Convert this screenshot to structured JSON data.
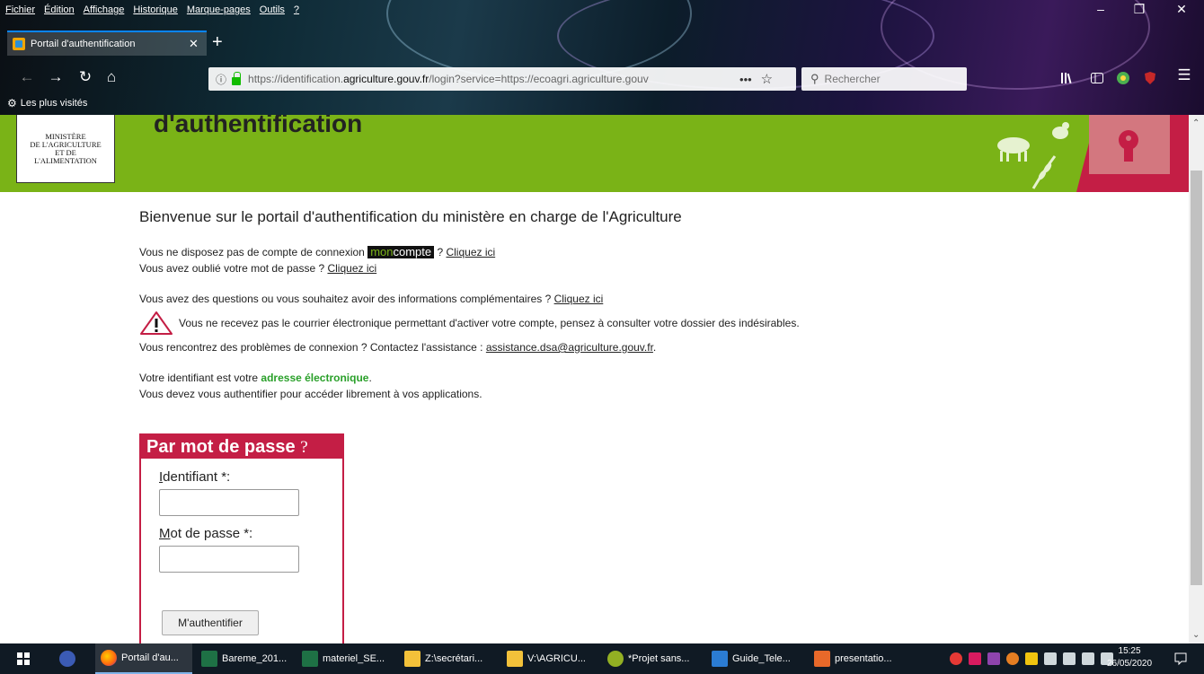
{
  "browser": {
    "menu": [
      "Fichier",
      "Édition",
      "Affichage",
      "Historique",
      "Marque-pages",
      "Outils",
      "?"
    ],
    "tab_title": "Portail d'authentification",
    "new_tab": "+",
    "url_host_prefix": "https://identification.",
    "url_domain": "agriculture.gouv.fr",
    "url_rest": "/login?service=https://ecoagri.agriculture.gouv",
    "search_placeholder": "Rechercher",
    "bookmark": "Les plus visités"
  },
  "banner": {
    "title": "d'authentification",
    "logo_lines": [
      "MINISTÈRE",
      "DE L'AGRICULTURE",
      "ET DE",
      "L'ALIMENTATION"
    ]
  },
  "content": {
    "welcome": "Bienvenue sur le portail d'authentification du ministère en charge de l'Agriculture",
    "no_account_text": "Vous ne disposez pas de compte de connexion ",
    "moncompte_a": "mon",
    "moncompte_b": "compte",
    "no_account_after": " ? ",
    "click_here": "Cliquez ici",
    "forgot_text": "Vous avez oublié votre mot de passe ? ",
    "questions_text": "Vous avez des questions ou vous souhaitez avoir des informations complémentaires ? ",
    "warning_text": "Vous ne recevez pas le courrier électronique permettant d'activer votre compte, pensez à consulter votre dossier des indésirables.",
    "problems_text": "Vous rencontrez des problèmes de connexion ? Contactez l'assistance : ",
    "assistance_email": "assistance.dsa@agriculture.gouv.fr",
    "period": ".",
    "id_text": "Votre identifiant est votre ",
    "id_strong": "adresse électronique",
    "auth_text": "Vous devez vous authentifier pour accéder librement à vos applications."
  },
  "login": {
    "heading": "Par mot de passe",
    "help": "?",
    "id_label_u": "I",
    "id_label_rest": "dentifiant *:",
    "pw_label_u": "M",
    "pw_label_rest": "ot de passe *:",
    "id_value": "",
    "pw_value": "",
    "submit": "M'authentifier"
  },
  "taskbar": {
    "items": [
      "Portail d'au...",
      "Bareme_201...",
      "materiel_SE...",
      "Z:\\secrétari...",
      "V:\\AGRICU...",
      "*Projet sans...",
      "Guide_Tele...",
      "presentatio..."
    ],
    "time": "15:25",
    "date": "26/05/2020"
  },
  "colors": {
    "banner_green": "#7ab317",
    "accent_red": "#c41e45",
    "email_green": "#2aa02a"
  }
}
